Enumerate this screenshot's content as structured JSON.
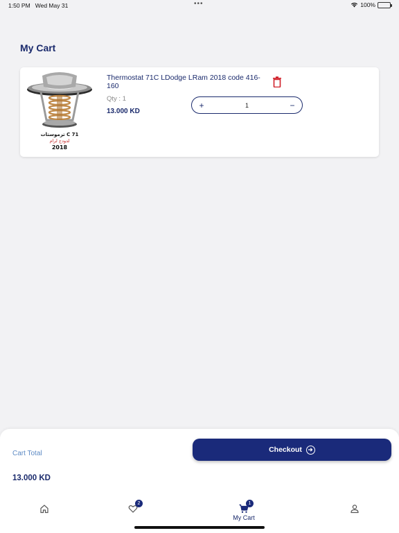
{
  "status_bar": {
    "time": "1:50 PM",
    "date": "Wed May 31",
    "battery": "100%"
  },
  "page": {
    "title": "My Cart"
  },
  "cart_items": [
    {
      "name": "Thermostat 71C LDodge LRam 2018 code 416-160",
      "qty_label": "Qty : 1",
      "price": "13.000 KD",
      "quantity": "1",
      "image_caption_line1": "ترموستات C 71",
      "image_caption_line2": "لدودج لرام",
      "image_caption_line3": "2018"
    }
  ],
  "summary": {
    "cart_total_label": "Cart Total",
    "cart_total_value": "13.000 KD",
    "checkout_label": "Checkout"
  },
  "tab_bar": {
    "favorites_badge": "2",
    "cart_badge": "1",
    "cart_label": "My Cart"
  },
  "colors": {
    "primary": "#1a2a7a",
    "delete": "#d0202a",
    "accent_label": "#5d8ac4"
  },
  "icons": {
    "home": "home-icon",
    "heart": "heart-icon",
    "cart": "cart-icon",
    "profile": "profile-icon",
    "trash": "trash-icon",
    "arrow": "arrow-right-circle-icon"
  }
}
